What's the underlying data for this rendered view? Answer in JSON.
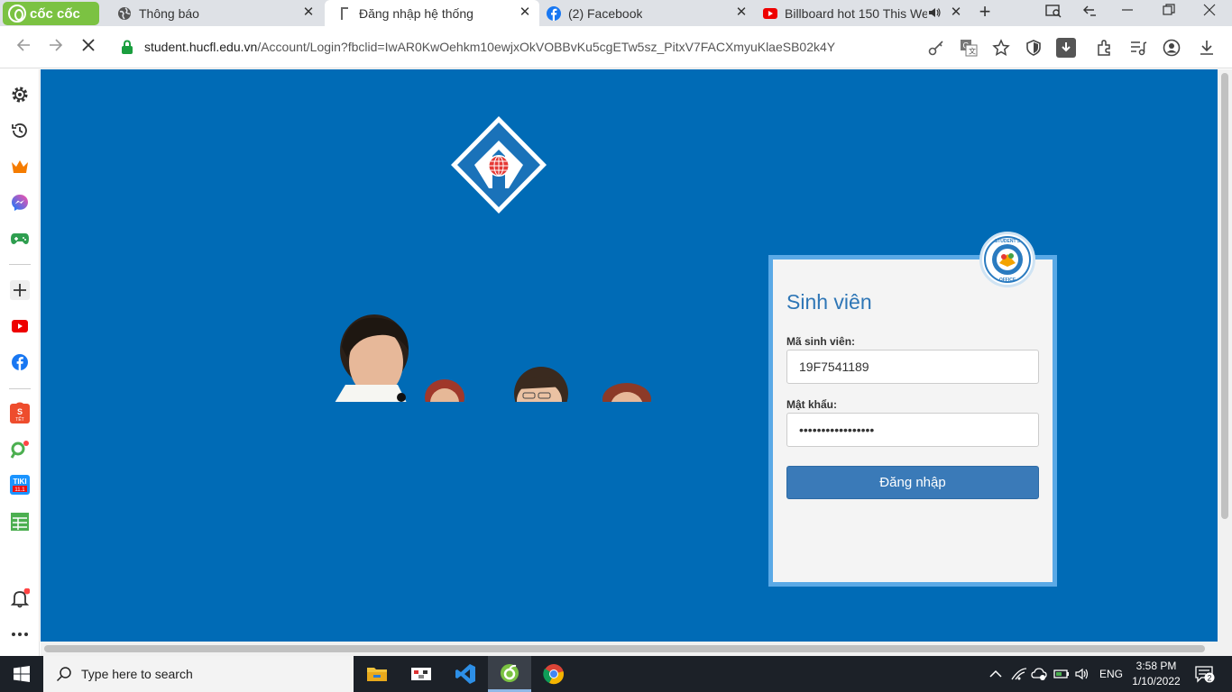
{
  "browser": {
    "brand": "cốc cốc",
    "tabs": [
      {
        "label": "Thông báo",
        "active": false
      },
      {
        "label": "Đăng nhập hệ thống",
        "active": true
      },
      {
        "label": "(2) Facebook",
        "active": false
      },
      {
        "label": "Billboard hot 150 This We",
        "active": false
      }
    ],
    "url_host": "student.hucfl.edu.vn",
    "url_path": "/Account/Login?fbclid=IwAR0KwOehkm10ewjxOkVOBBvKu5cgETw5sz_PitxV7FACXmyuKlaeSB02k4Y"
  },
  "sidebar": {
    "items": [
      "settings",
      "history",
      "crown",
      "messenger",
      "game",
      "add",
      "youtube",
      "facebook",
      "shopee",
      "map",
      "tiki",
      "sheets",
      "notifications",
      "more"
    ]
  },
  "login": {
    "title": "Sinh viên",
    "student_id_label": "Mã sinh viên:",
    "student_id_value": "19F7541189",
    "password_label": "Mật khẩu:",
    "password_value": "•••••••••••••••••",
    "submit_label": "Đăng nhập",
    "badge_text": "STUDENT'S OFFICE"
  },
  "taskbar": {
    "search_placeholder": "Type here to search",
    "language": "ENG",
    "time": "3:58 PM",
    "date": "1/10/2022",
    "notifications": "2"
  },
  "colors": {
    "page_bg": "#006bb6",
    "card_border": "#5aa9e6",
    "button": "#3a7ab8",
    "brand": "#7bc242"
  }
}
